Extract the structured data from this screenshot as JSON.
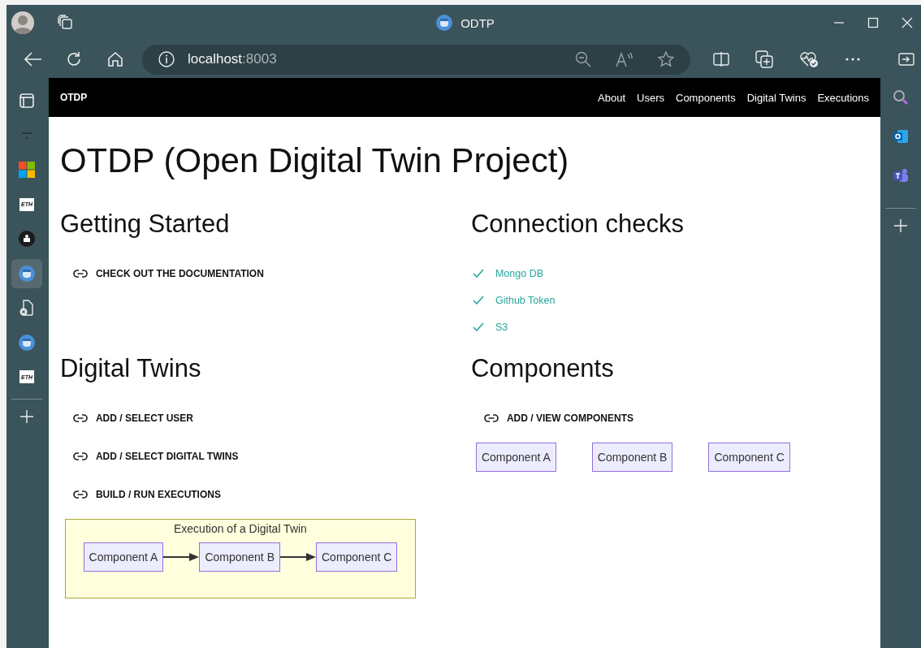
{
  "browser": {
    "title": "ODTP",
    "address": {
      "host": "localhost",
      "port": ":8003"
    }
  },
  "vertical_tabs": [
    {
      "kind": "panel",
      "selected": false
    },
    {
      "kind": "collapsed",
      "selected": false
    },
    {
      "kind": "windows",
      "selected": false
    },
    {
      "kind": "eth",
      "label": "ETH",
      "selected": false
    },
    {
      "kind": "dark",
      "selected": false
    },
    {
      "kind": "odtp",
      "selected": true
    },
    {
      "kind": "file-x",
      "selected": false
    },
    {
      "kind": "odtp",
      "selected": false
    },
    {
      "kind": "eth",
      "label": "ETH",
      "selected": false
    }
  ],
  "page": {
    "brand": "OTDP",
    "nav": [
      "About",
      "Users",
      "Components",
      "Digital Twins",
      "Executions"
    ],
    "title": "OTDP (Open Digital Twin Project)",
    "getting_started": {
      "heading": "Getting Started",
      "links": [
        "CHECK OUT THE DOCUMENTATION"
      ]
    },
    "connection_checks": {
      "heading": "Connection checks",
      "items": [
        {
          "label": "Mongo DB",
          "ok": true
        },
        {
          "label": "Github Token",
          "ok": true
        },
        {
          "label": "S3",
          "ok": true
        }
      ]
    },
    "digital_twins": {
      "heading": "Digital Twins",
      "links": [
        "ADD / SELECT USER",
        "ADD / SELECT DIGITAL TWINS",
        "BUILD / RUN EXECUTIONS"
      ],
      "diagram": {
        "title": "Execution of a Digital Twin",
        "nodes": [
          "Component A",
          "Component B",
          "Component C"
        ]
      }
    },
    "components": {
      "heading": "Components",
      "links": [
        "ADD / VIEW COMPONENTS"
      ],
      "nodes": [
        "Component A",
        "Component B",
        "Component C"
      ]
    }
  }
}
